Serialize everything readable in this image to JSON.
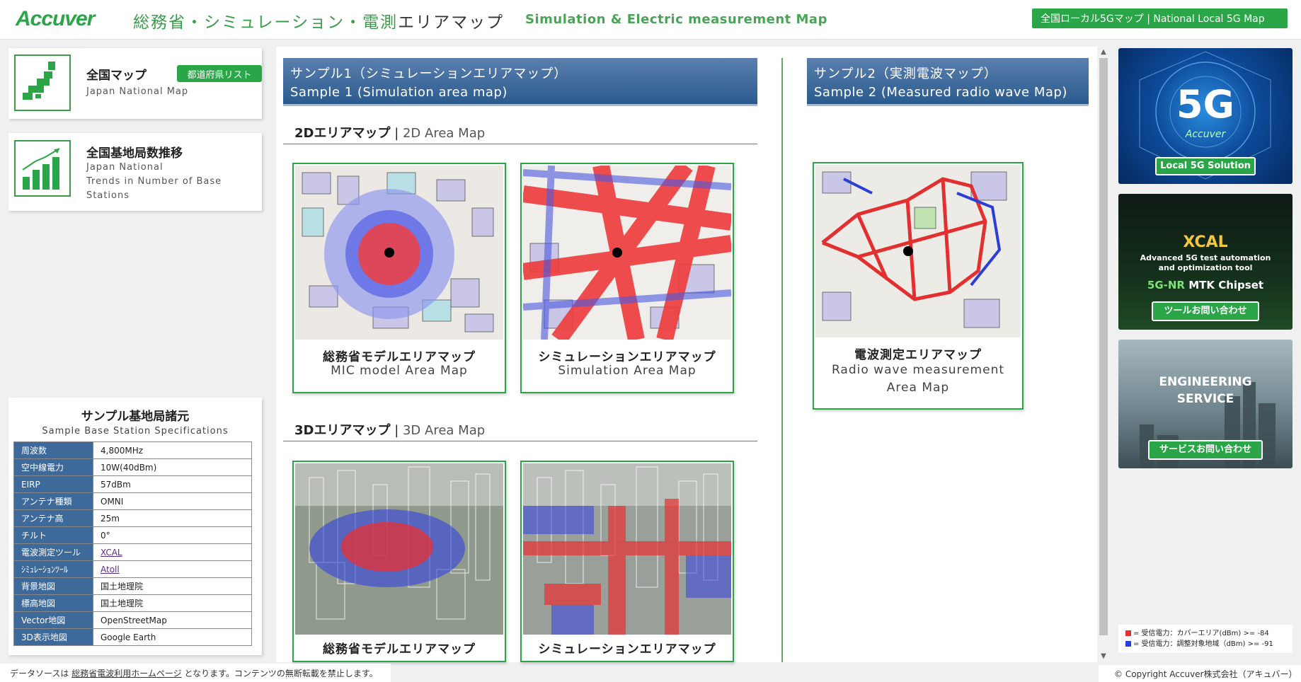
{
  "header": {
    "logo": "Accuver",
    "title_jp_green": "総務省・シミュレーション・電測",
    "title_jp_dark": "エリアマップ",
    "title_en": "Simulation & Electric measurement Map",
    "local5g_button": "全国ローカル5Gマップ | National Local 5G Map"
  },
  "sidebar": {
    "national_map": {
      "title": "全国マップ",
      "subtitle": "Japan National Map",
      "pref_button": "都道府県リスト"
    },
    "station_trend": {
      "title": "全国基地局数推移",
      "sub_line1": "Japan National",
      "sub_line2": "Trends in Number of Base",
      "sub_line3": "Stations"
    },
    "specs": {
      "title": "サンプル基地局諸元",
      "subtitle": "Sample Base Station Specifications",
      "rows": [
        {
          "key": "周波数",
          "value": "4,800MHz"
        },
        {
          "key": "空中線電力",
          "value": "10W(40dBm)"
        },
        {
          "key": "EIRP",
          "value": "57dBm"
        },
        {
          "key": "アンテナ種類",
          "value": "OMNI"
        },
        {
          "key": "アンテナ高",
          "value": "25m"
        },
        {
          "key": "チルト",
          "value": "0°"
        },
        {
          "key": "電波測定ツール",
          "value": "XCAL"
        },
        {
          "key": "ｼﾐｭﾚｰｼｮﾝﾂｰﾙ",
          "value": "Atoll"
        },
        {
          "key": "背景地図",
          "value": "国土地理院"
        },
        {
          "key": "標高地図",
          "value": "国土地理院"
        },
        {
          "key": "Vector地図",
          "value": "OpenStreetMap"
        },
        {
          "key": "3D表示地図",
          "value": "Google Earth"
        }
      ]
    }
  },
  "main": {
    "sample1": {
      "jp": "サンプル1（シミュレーションエリアマップ）",
      "en": "Sample 1 (Simulation area map)"
    },
    "sample2": {
      "jp": "サンプル2（実測電波マップ）",
      "en": "Sample 2 (Measured radio wave Map)"
    },
    "section_2d": {
      "jp": "2Dエリアマップ",
      "sep": " | ",
      "en": "2D Area Map"
    },
    "section_3d": {
      "jp": "3Dエリアマップ",
      "sep": " | ",
      "en": "3D Area Map"
    },
    "cards": {
      "mic_2d": {
        "jp": "総務省モデルエリアマップ",
        "en": "MIC model Area Map"
      },
      "sim_2d": {
        "jp": "シミュレーションエリアマップ",
        "en": "Simulation Area Map"
      },
      "radio_2d": {
        "jp": "電波測定エリアマップ",
        "en1": "Radio wave measurement",
        "en2": "Area Map"
      },
      "mic_3d": {
        "jp": "総務省モデルエリアマップ"
      },
      "sim_3d": {
        "jp": "シミュレーションエリアマップ"
      }
    }
  },
  "ads": {
    "ad1": {
      "big": "5G",
      "brand": "Accuver",
      "button": "Local 5G Solution"
    },
    "ad2": {
      "title": "XCAL",
      "line1": "Advanced 5G test automation",
      "line2": "and optimization tool",
      "chip_green": "5G-NR",
      "chip_white": " MTK Chipset",
      "button": "ツールお問い合わせ"
    },
    "ad3": {
      "line1": "ENGINEERING",
      "line2": "SERVICE",
      "button": "サービスお問い合わせ"
    }
  },
  "legend": {
    "red_label": "= 受信電力：カバーエリア(dBm) >= -84",
    "blue_label": "= 受信電力：調整対象地域（dBm) >= -91",
    "red_color": "#e53030",
    "blue_color": "#2b3fd6"
  },
  "footer": {
    "prefix": "データソースは ",
    "link": "総務省電波利用ホームページ",
    "suffix": " となります。コンテンツの無断転載を禁止します。",
    "copyright": "© Copyright Accuver株式会社（アキュバー）"
  },
  "colors": {
    "accent_green": "#2aa547",
    "header_blue": "#2b5b8e",
    "table_key_blue": "#3d6a9b"
  }
}
